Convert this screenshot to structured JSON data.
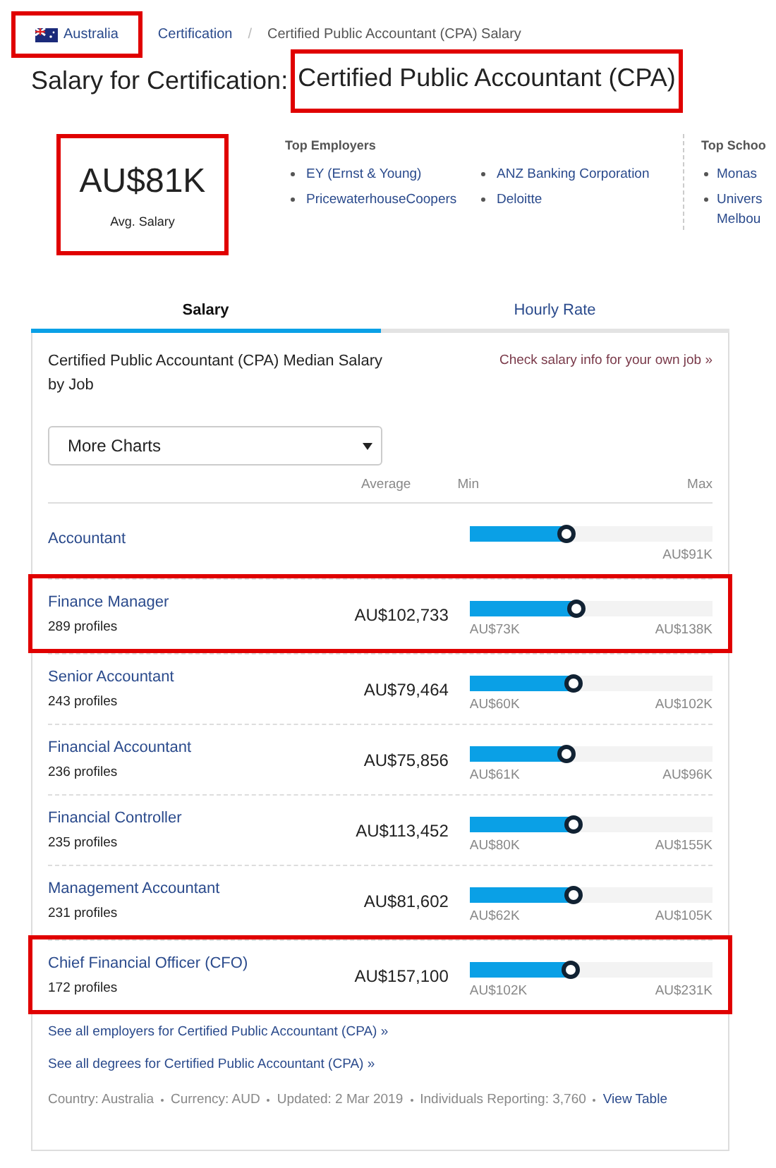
{
  "breadcrumbs": [
    {
      "label": "Australia",
      "flag": true,
      "highlighted": true
    },
    {
      "label": "Certification",
      "highlighted": false
    },
    {
      "label": "Certified Public Accountant (CPA) Salary",
      "current": true,
      "separator": "/",
      "highlighted": false
    }
  ],
  "title": {
    "prefix": "Salary for Certification:",
    "name": "Certified Public Accountant (CPA)",
    "highlighted": true
  },
  "summary": {
    "value": "AU$81K",
    "label": "Avg. Salary",
    "highlighted": true
  },
  "top_employers": {
    "heading": "Top Employers",
    "items": [
      "EY (Ernst & Young)",
      "ANZ Banking Corporation",
      "PricewaterhouseCoopers",
      "Deloitte"
    ]
  },
  "top_schools": {
    "heading": "Top Schoo",
    "items": [
      "Monas",
      "Univers Melbou"
    ]
  },
  "tabs": [
    {
      "label": "Salary",
      "selected": true
    },
    {
      "label": "Hourly Rate",
      "selected": false
    }
  ],
  "panel": {
    "title": "Certified Public Accountant (CPA) Median Salary by Job",
    "own_job_link": "Check salary info for your own job »",
    "dropdown": "More Charts",
    "columns": [
      "Average",
      "Min",
      "Max"
    ],
    "rows": [
      {
        "name": "Accountant",
        "max": "AU$91K",
        "level": 0.4,
        "highlighted": false
      },
      {
        "name": "Finance Manager",
        "profiles": "289 profiles",
        "average": "AU$102,733",
        "min": "AU$73K",
        "max": "AU$138K",
        "level": 0.44,
        "highlighted": true
      },
      {
        "name": "Senior Accountant",
        "profiles": "243 profiles",
        "average": "AU$79,464",
        "min": "AU$60K",
        "max": "AU$102K",
        "level": 0.43,
        "highlighted": false
      },
      {
        "name": "Financial Accountant",
        "profiles": "236 profiles",
        "average": "AU$75,856",
        "min": "AU$61K",
        "max": "AU$96K",
        "level": 0.4,
        "highlighted": false
      },
      {
        "name": "Financial Controller",
        "profiles": "235 profiles",
        "average": "AU$113,452",
        "min": "AU$80K",
        "max": "AU$155K",
        "level": 0.43,
        "highlighted": false
      },
      {
        "name": "Management Accountant",
        "profiles": "231 profiles",
        "average": "AU$81,602",
        "min": "AU$62K",
        "max": "AU$105K",
        "level": 0.43,
        "highlighted": false
      },
      {
        "name": "Chief Financial Officer (CFO)",
        "profiles": "172 profiles",
        "average": "AU$157,100",
        "min": "AU$102K",
        "max": "AU$231K",
        "level": 0.42,
        "highlighted": true
      }
    ],
    "links": [
      "See all employers for Certified Public Accountant (CPA) »",
      "See all degrees for Certified Public Accountant (CPA) »"
    ],
    "footer": [
      "Country: Australia",
      "Currency: AUD",
      "Updated: 2 Mar 2019",
      "Individuals Reporting: 3,760"
    ],
    "footer_link": "View Table"
  }
}
